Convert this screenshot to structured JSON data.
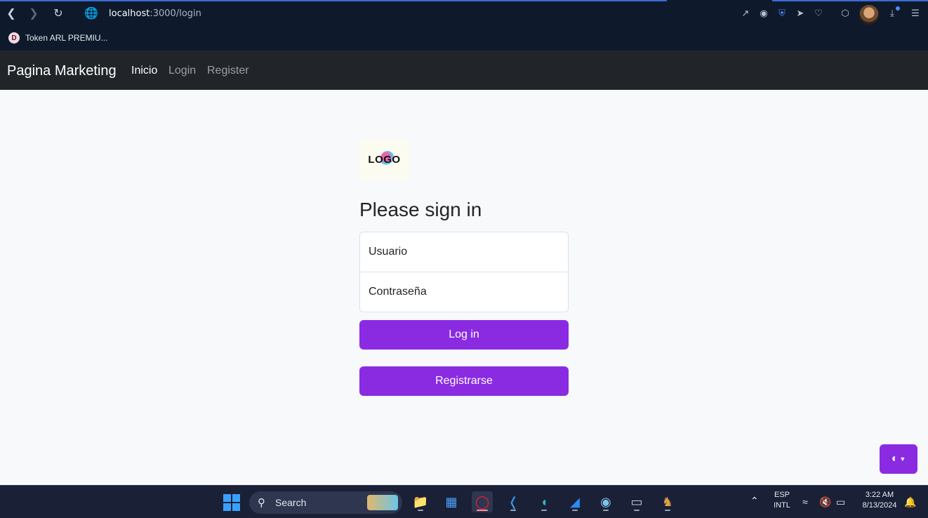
{
  "browser": {
    "url_host": "localhost",
    "url_path": ":3000/login",
    "bookmark_label": "Token ARL PREMIU..."
  },
  "navbar": {
    "brand": "Pagina Marketing",
    "links": [
      "Inicio",
      "Login",
      "Register"
    ]
  },
  "form": {
    "logo_text": "LOGO",
    "heading": "Please sign in",
    "username_placeholder": "Usuario",
    "password_placeholder": "Contraseña",
    "login_label": "Log in",
    "register_label": "Registrarse"
  },
  "taskbar": {
    "search_label": "Search",
    "language": "ESP",
    "layout": "INTL",
    "time": "3:22 AM",
    "date": "8/13/2024"
  },
  "colors": {
    "accent": "#8a2be2",
    "navbar_bg": "#212529",
    "browser_bg": "#0e1a2b"
  }
}
